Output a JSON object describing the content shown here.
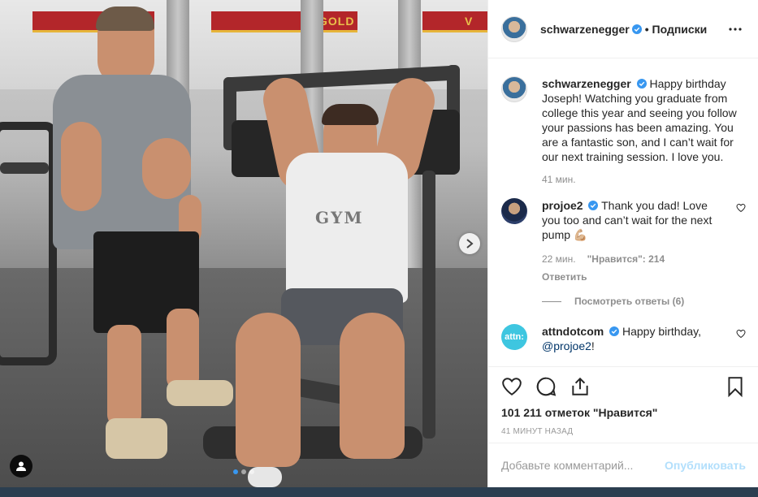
{
  "post": {
    "author": "schwarzenegger",
    "follow_label": "• Подписки",
    "more_label": "more-options"
  },
  "caption": {
    "username": "schwarzenegger",
    "text": "Happy birthday Joseph! Watching you graduate from college this year and seeing you follow your passions has been amazing. You are a fantastic son, and I can’t wait for our next training session. I love you.",
    "time": "41 мин."
  },
  "comments": [
    {
      "username": "projoe2",
      "text": "Thank you dad! Love you too and can’t wait for the next pump 💪🏼",
      "time": "22 мин.",
      "likes": "\"Нравится\": 214",
      "reply": "Ответить",
      "view_replies": "Посмотреть ответы (6)"
    },
    {
      "username": "attndotcom",
      "avatar_text": "attn:",
      "text_before": "Happy birthday,",
      "mention": "@projoe2",
      "text_after": "!"
    }
  ],
  "actions": {
    "likes_count": "101 211 отметок \"Нравится\"",
    "timestamp": "41 минут назад"
  },
  "add_comment": {
    "placeholder": "Добавьте комментарий...",
    "post_label": "Опубликовать"
  },
  "photo": {
    "banner_text_1": "GOLD",
    "banner_text_2": "V",
    "shirt_text": "GYM",
    "carousel_index": 1,
    "carousel_count": 3
  },
  "colors": {
    "verified": "#3897f0",
    "post_button": "#b2dffc",
    "mention": "#003569",
    "banner": "#b3262a"
  }
}
